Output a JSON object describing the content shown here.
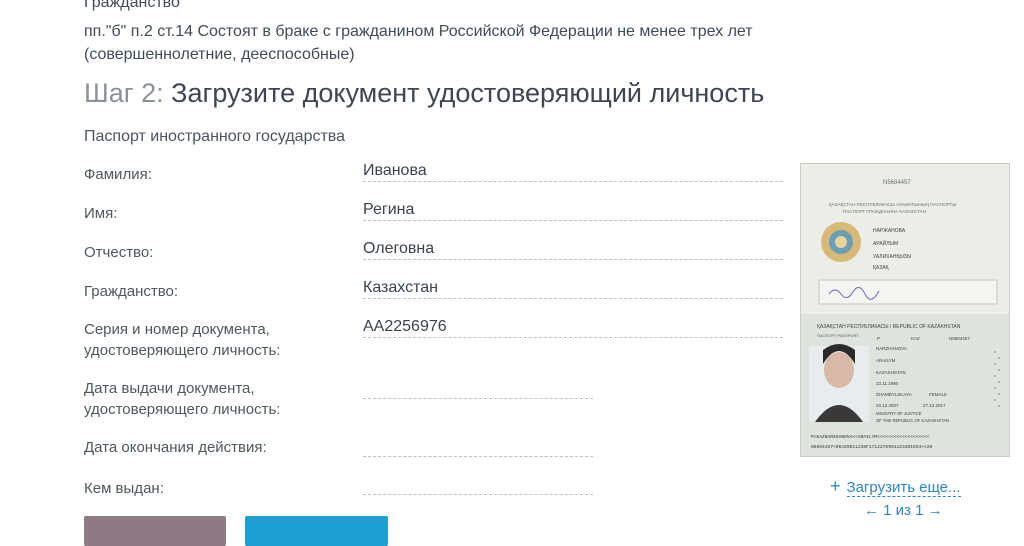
{
  "header": {
    "line1": "Гражданство",
    "line2": "пп.\"б\" п.2 ст.14 Состоят в браке с гражданином Российской Федерации не менее трех лет",
    "line3": "(совершеннолетние, дееспособные)"
  },
  "step": {
    "number": "Шаг 2:",
    "title": "Загрузите документ удостоверяющий личность"
  },
  "document_type": "Паспорт иностранного государства",
  "fields": {
    "surname": {
      "label": "Фамилия:",
      "value": "Иванова"
    },
    "name": {
      "label": "Имя:",
      "value": "Регина"
    },
    "patronymic": {
      "label": "Отчество:",
      "value": "Олеговна"
    },
    "citizenship": {
      "label": "Гражданство:",
      "value": "Казахстан"
    },
    "doc_number": {
      "label_l1": "Серия и номер документа,",
      "label_l2": "удостоверяющего личность:",
      "value": "AA2256976"
    },
    "issue_date": {
      "label_l1": "Дата выдачи документа,",
      "label_l2": "удостоверяющего личность:",
      "value": ""
    },
    "expiry_date": {
      "label": "Дата окончания действия:",
      "value": ""
    },
    "issued_by": {
      "label": "Кем выдан:",
      "value": ""
    }
  },
  "upload": {
    "plus": "+",
    "label": "Загрузить еще...",
    "pager": "← 1 из 1 →"
  },
  "passport": {
    "top_header": "ҚАЗАҚСТАН РЕСПУБЛИКАСЫ АЗАМАТЫНЫҢ ПАСПОРТЫ",
    "top_header2": "ПАСПОРТ ГРАЖДАНИНА КАЗАХСТАН",
    "top_number": "N5684457",
    "name1": "НАРЖАНОВА",
    "name2": "АРАЙЛЫМ",
    "name3": "УАЛИХАНҚЫЗЫ",
    "nat": "ҚАЗАҚ",
    "bottom_header": "ҚАЗАҚСТАН РЕСПУБЛИКАСЫ / REPUBLIC OF KAZAKHSTAN",
    "type_label": "ПАСПОРТ PASSPORT",
    "type": "P",
    "code": "KAZ",
    "number": "N5684457",
    "surname": "NARZHANOVA",
    "given": "ARAILYM",
    "country": "KAZAKHSTAN",
    "dob": "23.11.1990",
    "place": "ZHAMBYLSKAYA",
    "sex": "FEMALE",
    "issue": "26.12.2007",
    "expiry": "27.12.2017",
    "authority": "MINISTRY OF JUSTICE",
    "authority2": "OF THE REPUBLIC OF KAZAKHSTAN",
    "mrz1": "P<KAZNARZHANOVA<<ARAILYM<<<<<<<<<<<<<<<<<<<",
    "mrz2": "N5684457<0KAZ9011230F1712276901123401034<<20"
  },
  "colors": {
    "link": "#2f86c4",
    "button_primary": "#1f9ed3",
    "button_secondary": "#8d7a85"
  }
}
